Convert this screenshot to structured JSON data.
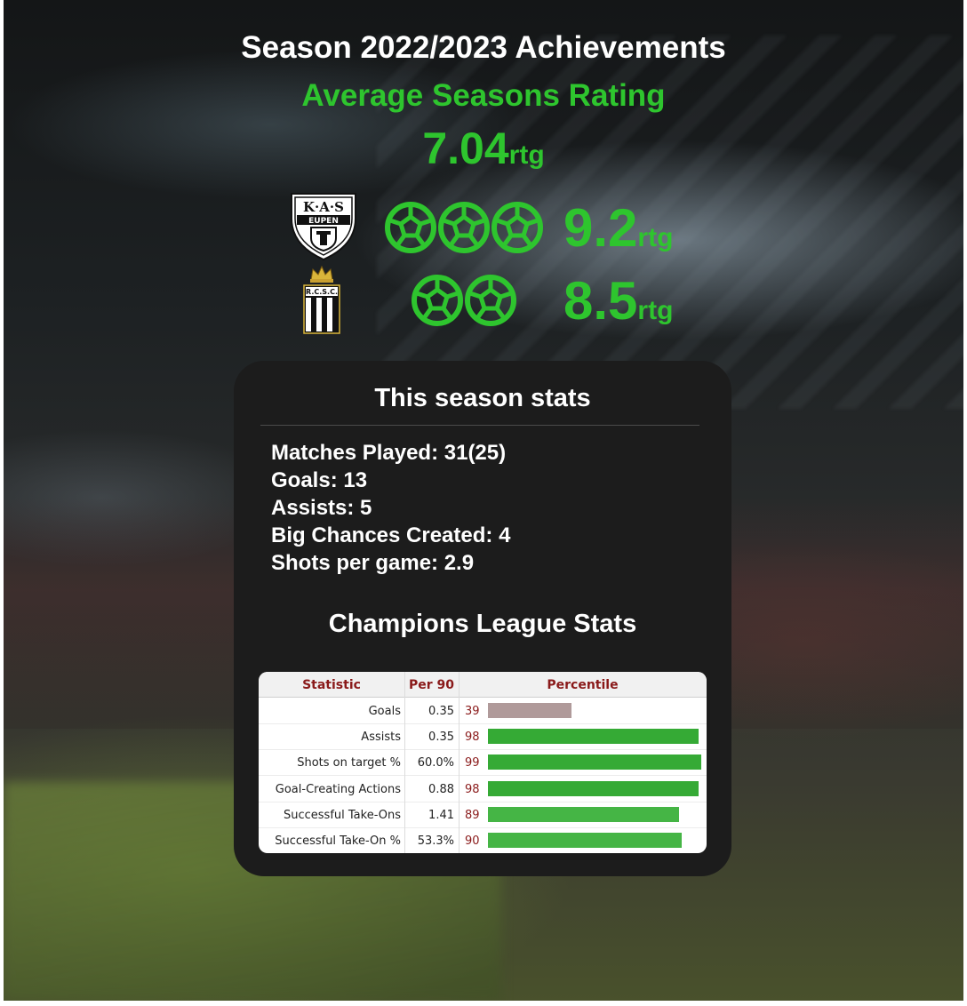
{
  "title": "Season 2022/2023 Achievements",
  "subtitle": "Average Seasons Rating",
  "average_rating": {
    "value": "7.04",
    "unit": "rtg"
  },
  "clubs": [
    {
      "logo_text_top": "K·A·S",
      "logo_text_bottom": "EUPEN",
      "balls": 3,
      "rating": "9.2",
      "unit": "rtg"
    },
    {
      "logo_text": "R.C.S.C.",
      "balls": 2,
      "rating": "8.5",
      "unit": "rtg"
    }
  ],
  "season_stats": {
    "title": "This season stats",
    "lines": [
      "Matches Played: 31(25)",
      "Goals: 13",
      "Assists: 5",
      "Big Chances Created: 4",
      "Shots per game: 2.9"
    ]
  },
  "champions_league": {
    "title": "Champions League Stats",
    "headers": {
      "statistic": "Statistic",
      "per90": "Per 90",
      "percentile": "Percentile"
    },
    "rows": [
      {
        "stat": "Goals",
        "per90": "0.35",
        "percentile": 39
      },
      {
        "stat": "Assists",
        "per90": "0.35",
        "percentile": 98
      },
      {
        "stat": "Shots on target %",
        "per90": "60.0%",
        "percentile": 99
      },
      {
        "stat": "Goal-Creating Actions",
        "per90": "0.88",
        "percentile": 98
      },
      {
        "stat": "Successful Take-Ons",
        "per90": "1.41",
        "percentile": 89
      },
      {
        "stat": "Successful Take-On %",
        "per90": "53.3%",
        "percentile": 90
      }
    ]
  },
  "colors": {
    "accent_green": "#2ec52e",
    "bar_high": "#35aa35",
    "bar_mid": "#45b545",
    "bar_low": "#b09a9a",
    "header_red": "#8a1a1a"
  },
  "icons": [
    "football-icon",
    "kas-eupen-crest",
    "rcsc-crest"
  ]
}
